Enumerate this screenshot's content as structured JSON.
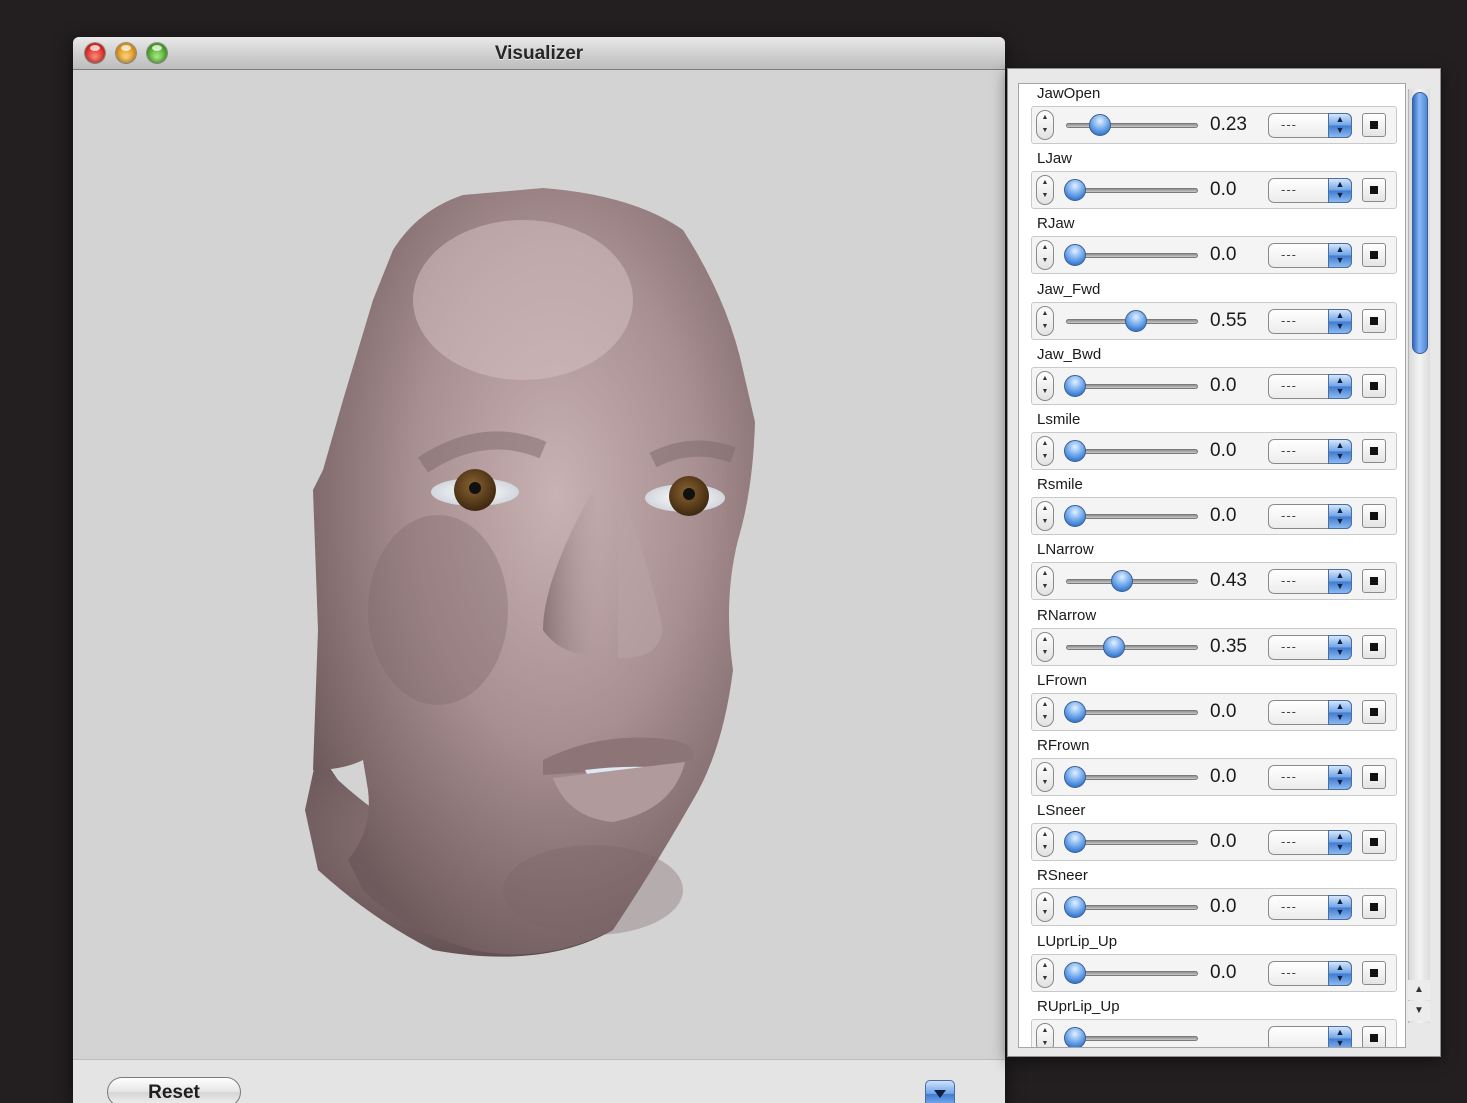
{
  "window": {
    "title": "Visualizer",
    "traffic_lights": [
      "close-icon",
      "minimize-icon",
      "zoom-icon"
    ],
    "reset_label": "Reset",
    "menu_icon": "triangle-down-icon"
  },
  "controls": [
    {
      "label": "JawOpen",
      "value": "0.23",
      "level": 0.23,
      "mode": "---"
    },
    {
      "label": "LJaw",
      "value": "0.0",
      "level": 0.0,
      "mode": "---"
    },
    {
      "label": "RJaw",
      "value": "0.0",
      "level": 0.0,
      "mode": "---"
    },
    {
      "label": "Jaw_Fwd",
      "value": "0.55",
      "level": 0.55,
      "mode": "---"
    },
    {
      "label": "Jaw_Bwd",
      "value": "0.0",
      "level": 0.0,
      "mode": "---"
    },
    {
      "label": "Lsmile",
      "value": "0.0",
      "level": 0.0,
      "mode": "---"
    },
    {
      "label": "Rsmile",
      "value": "0.0",
      "level": 0.0,
      "mode": "---"
    },
    {
      "label": "LNarrow",
      "value": "0.43",
      "level": 0.43,
      "mode": "---"
    },
    {
      "label": "RNarrow",
      "value": "0.35",
      "level": 0.35,
      "mode": "---"
    },
    {
      "label": "LFrown",
      "value": "0.0",
      "level": 0.0,
      "mode": "---"
    },
    {
      "label": "RFrown",
      "value": "0.0",
      "level": 0.0,
      "mode": "---"
    },
    {
      "label": "LSneer",
      "value": "0.0",
      "level": 0.0,
      "mode": "---"
    },
    {
      "label": "RSneer",
      "value": "0.0",
      "level": 0.0,
      "mode": "---"
    },
    {
      "label": "LUprLip_Up",
      "value": "0.0",
      "level": 0.0,
      "mode": "---"
    },
    {
      "label": "RUprLip_Up",
      "value": "",
      "level": 0.0,
      "mode": ""
    }
  ],
  "colors": {
    "face_skin": "#a88f91",
    "viewport_bg": "#d3d3d3",
    "iris": "#5a3c17",
    "accent_blue": "#3f7bd0"
  }
}
